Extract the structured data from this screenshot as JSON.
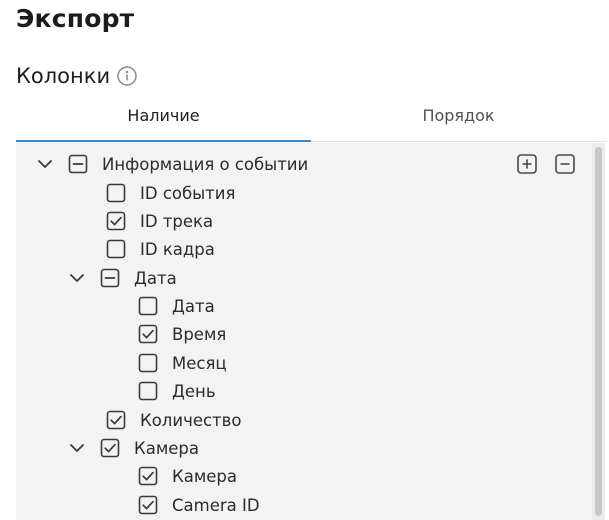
{
  "header": {
    "title": "Экспорт"
  },
  "section": {
    "title": "Колонки",
    "info_icon": "info-icon"
  },
  "tabs": [
    {
      "label": "Наличие",
      "active": true
    },
    {
      "label": "Порядок",
      "active": false
    }
  ],
  "tree": {
    "expand_all_icon": "plus-square-icon",
    "collapse_all_icon": "minus-square-icon",
    "rows": [
      {
        "label": "Информация о событии",
        "state": "indeterminate",
        "expanded": true
      },
      {
        "label": "ID события",
        "state": "unchecked"
      },
      {
        "label": "ID трека",
        "state": "checked"
      },
      {
        "label": "ID кадра",
        "state": "unchecked"
      },
      {
        "label": "Дата",
        "state": "indeterminate",
        "expanded": true
      },
      {
        "label": "Дата",
        "state": "unchecked"
      },
      {
        "label": "Время",
        "state": "checked"
      },
      {
        "label": "Месяц",
        "state": "unchecked"
      },
      {
        "label": "День",
        "state": "unchecked"
      },
      {
        "label": "Количество",
        "state": "checked"
      },
      {
        "label": "Камера",
        "state": "checked",
        "expanded": true
      },
      {
        "label": "Камера",
        "state": "checked"
      },
      {
        "label": "Camera ID",
        "state": "checked"
      }
    ]
  },
  "colors": {
    "accent": "#3a86d8",
    "tree_bg": "#f3f3f3",
    "icon": "#3a3a3a"
  }
}
